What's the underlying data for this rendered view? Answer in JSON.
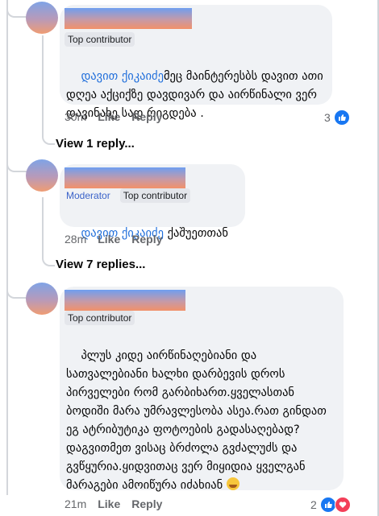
{
  "comments": [
    {
      "badges": [
        "Top contributor"
      ],
      "mention": "დავით ქიკაიძე",
      "text": "მეც მაინტერესბს დავით ათი დღეა აქციქზე დავდივარ და აირწინალი ვერ დავინახე სად რიგდება .",
      "time": "30m",
      "like": "Like",
      "reply": "Reply",
      "reaction_count": "3"
    },
    {
      "badges": [
        "Moderator",
        "Top contributor"
      ],
      "mention": "დავით ქიკაიძე",
      "text": " ქაშუეთთან",
      "time": "28m",
      "like": "Like",
      "reply": "Reply"
    },
    {
      "badges": [
        "Top contributor"
      ],
      "mention": "",
      "text": "პლუს კიდე აირწინაღებიანი და სათვალებიანი ხალხი დარბევის დროს პირველები რომ გარბიხართ.ყველასთან ბოდიში მარა უმრავლესობა ასეა.რათ გინდათ ეგ ატრიბუტიკა ფოტოების გადასაღებად?დაგვითმეთ ვისაც ბრძოლა გვძალუძს და გვწყურია.ყიდვითაც ვერ მიყიდია ყველგან მარაგები ამოიწურა იძახიან",
      "time": "21m",
      "like": "Like",
      "reply": "Reply",
      "reaction_count": "2"
    }
  ],
  "view_replies": [
    "View 1 reply...",
    "View 7 replies..."
  ],
  "icons": {
    "like": "like-icon",
    "love": "love-icon",
    "emoji": "rofl-emoji"
  },
  "colors": {
    "mention": "#216fdb",
    "bubble": "#f0f2f5",
    "like": "#1877f2",
    "love": "#f33e58"
  }
}
